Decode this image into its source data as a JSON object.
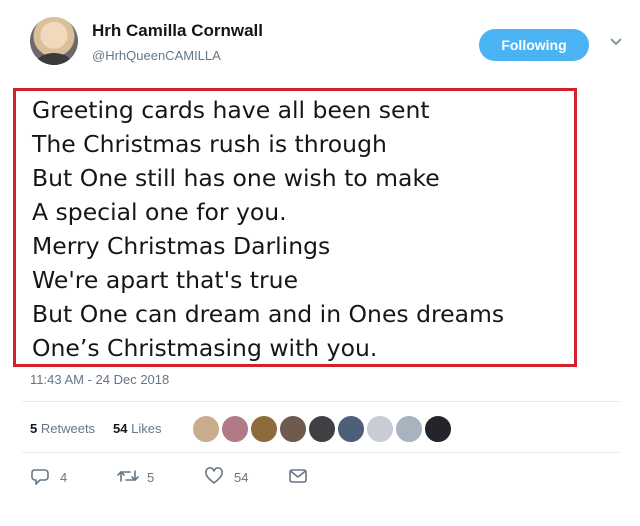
{
  "author": {
    "name": "Hrh Camilla Cornwall",
    "handle": "@HrhQueenCAMILLA"
  },
  "follow_button": {
    "label": "Following"
  },
  "tweet": {
    "lines": [
      "Greeting cards have all been sent",
      "The Christmas rush is through",
      "But One still has one wish to make",
      "A special one for you.",
      "Merry Christmas Darlings",
      "We're apart that's true",
      "But One can dream and in Ones dreams",
      "One’s Christmasing with you."
    ],
    "timestamp": "11:43 AM - 24 Dec 2018"
  },
  "stats": {
    "retweets_count": "5",
    "retweets_label": "Retweets",
    "likes_count": "54",
    "likes_label": "Likes"
  },
  "actions": {
    "reply_count": "4",
    "retweet_count": "5",
    "like_count": "54"
  },
  "colors": {
    "follow_button": "#4ab3f4",
    "highlight_border": "#d4202a",
    "muted_text": "#657786"
  },
  "icons": {
    "reply": "reply-icon",
    "retweet": "retweet-icon",
    "like": "heart-icon",
    "message": "message-icon",
    "more": "chevron-down-icon"
  }
}
